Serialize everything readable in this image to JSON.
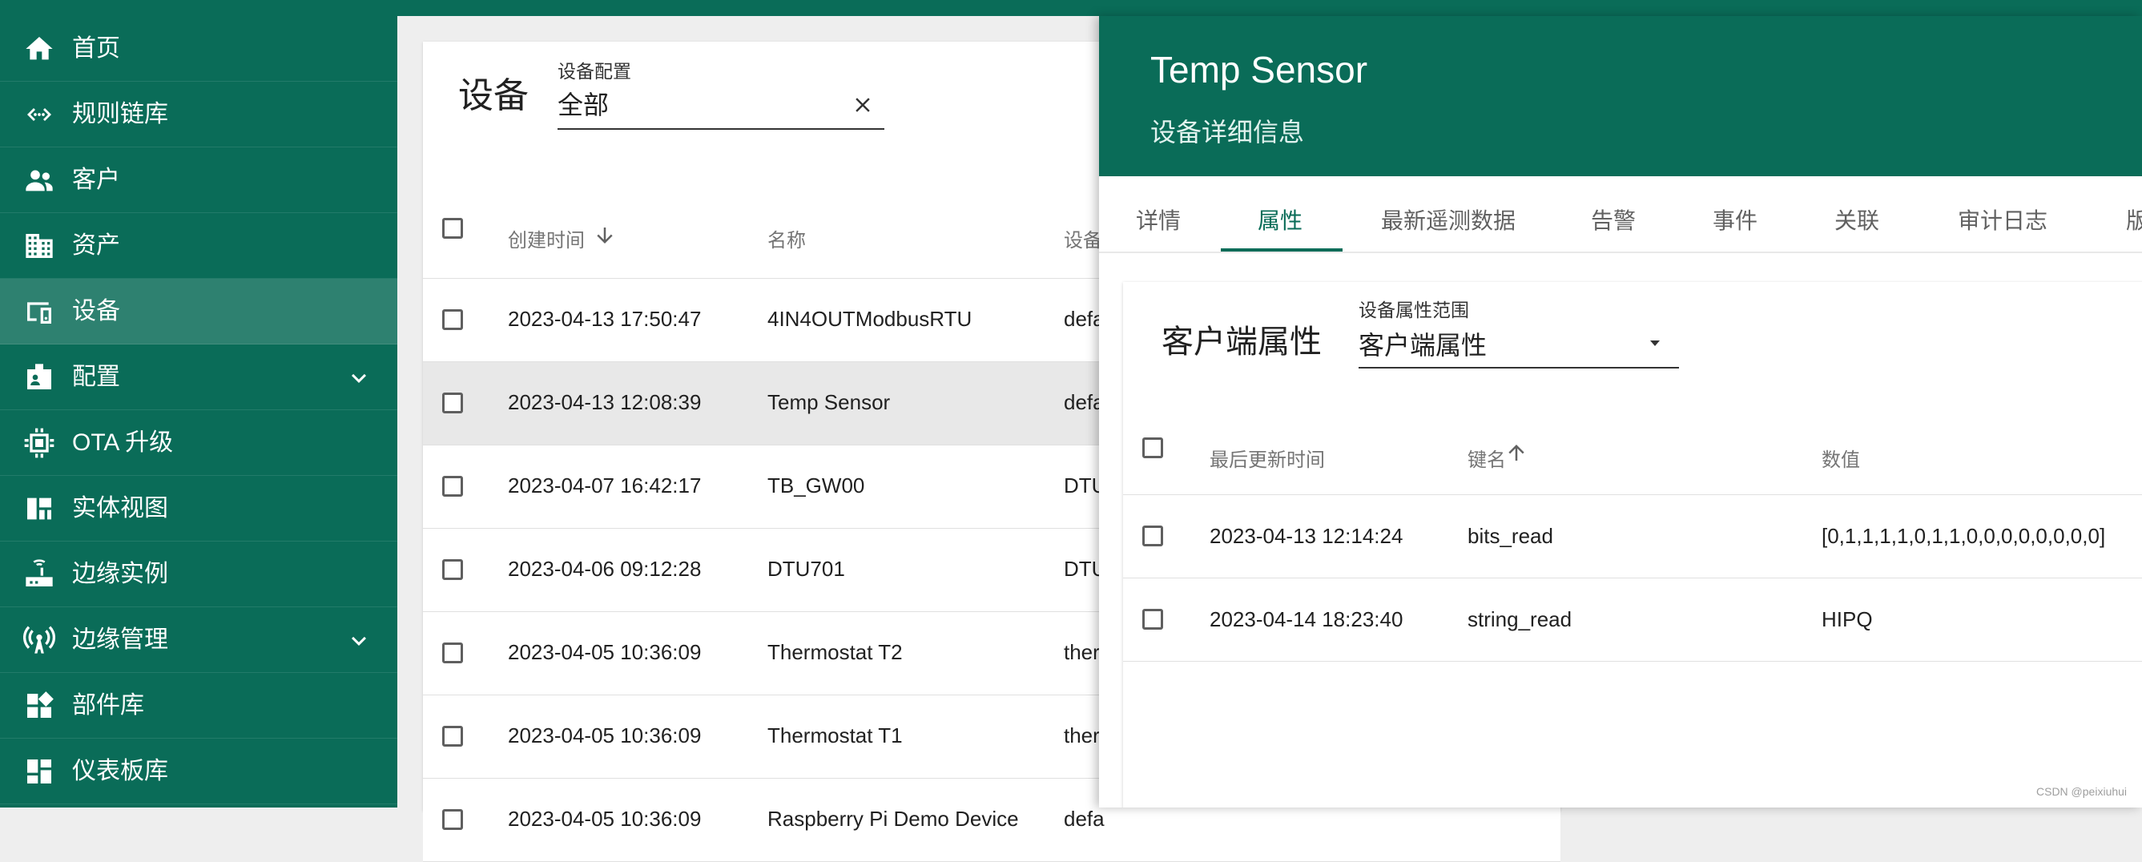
{
  "sidebar": {
    "items": [
      {
        "label": "首页",
        "icon": "home-icon",
        "chevron": false,
        "active": false
      },
      {
        "label": "规则链库",
        "icon": "code-arrows-icon",
        "chevron": false,
        "active": false
      },
      {
        "label": "客户",
        "icon": "people-icon",
        "chevron": false,
        "active": false
      },
      {
        "label": "资产",
        "icon": "building-icon",
        "chevron": false,
        "active": false
      },
      {
        "label": "设备",
        "icon": "devices-icon",
        "chevron": false,
        "active": true
      },
      {
        "label": "配置",
        "icon": "badge-icon",
        "chevron": true,
        "active": false
      },
      {
        "label": "OTA 升级",
        "icon": "chip-icon",
        "chevron": false,
        "active": false
      },
      {
        "label": "实体视图",
        "icon": "dashboard-view-icon",
        "chevron": false,
        "active": false
      },
      {
        "label": "边缘实例",
        "icon": "router-icon",
        "chevron": false,
        "active": false
      },
      {
        "label": "边缘管理",
        "icon": "signal-tower-icon",
        "chevron": true,
        "active": false
      },
      {
        "label": "部件库",
        "icon": "widgets-icon",
        "chevron": false,
        "active": false
      },
      {
        "label": "仪表板库",
        "icon": "grid-dashboard-icon",
        "chevron": false,
        "active": false
      }
    ]
  },
  "device_list": {
    "title": "设备",
    "filter": {
      "label": "设备配置",
      "value": "全部"
    },
    "columns": {
      "created_time": "创建时间",
      "name": "名称",
      "profile": "设备"
    },
    "rows": [
      {
        "created": "2023-04-13 17:50:47",
        "name": "4IN4OUTModbusRTU",
        "profile": "defa",
        "selected": false
      },
      {
        "created": "2023-04-13 12:08:39",
        "name": "Temp Sensor",
        "profile": "defa",
        "selected": true
      },
      {
        "created": "2023-04-07 16:42:17",
        "name": "TB_GW00",
        "profile": "DTU",
        "selected": false
      },
      {
        "created": "2023-04-06 09:12:28",
        "name": "DTU701",
        "profile": "DTU",
        "selected": false
      },
      {
        "created": "2023-04-05 10:36:09",
        "name": "Thermostat T2",
        "profile": "ther",
        "selected": false
      },
      {
        "created": "2023-04-05 10:36:09",
        "name": "Thermostat T1",
        "profile": "ther",
        "selected": false
      },
      {
        "created": "2023-04-05 10:36:09",
        "name": "Raspberry Pi Demo Device",
        "profile": "defa",
        "selected": false
      }
    ]
  },
  "drawer": {
    "title": "Temp Sensor",
    "subtitle": "设备详细信息",
    "tabs": [
      "详情",
      "属性",
      "最新遥测数据",
      "告警",
      "事件",
      "关联",
      "审计日志",
      "版"
    ],
    "active_tab": "属性",
    "attributes": {
      "title": "客户端属性",
      "scope_label": "设备属性范围",
      "scope_value": "客户端属性",
      "columns": {
        "last_update": "最后更新时间",
        "key": "键名",
        "value": "数值"
      },
      "rows": [
        {
          "time": "2023-04-13 12:14:24",
          "key": "bits_read",
          "value": "[0,1,1,1,1,0,1,1,0,0,0,0,0,0,0,0]"
        },
        {
          "time": "2023-04-14 18:23:40",
          "key": "string_read",
          "value": "HIPQ"
        }
      ]
    }
  },
  "watermark": "CSDN @peixiuhui",
  "colors": {
    "primary": "#0a6c58",
    "sidebar_active": "#2e8170",
    "selected_row": "#e8e8e8"
  }
}
